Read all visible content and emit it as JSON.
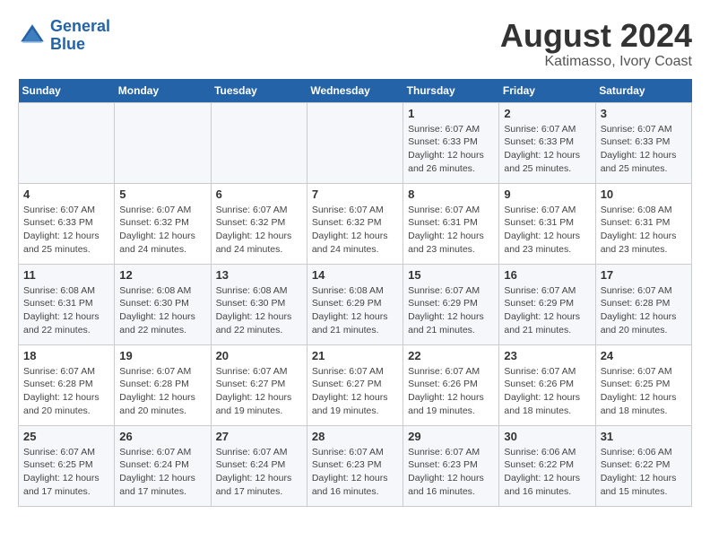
{
  "header": {
    "logo_line1": "General",
    "logo_line2": "Blue",
    "title": "August 2024",
    "subtitle": "Katimasso, Ivory Coast"
  },
  "weekdays": [
    "Sunday",
    "Monday",
    "Tuesday",
    "Wednesday",
    "Thursday",
    "Friday",
    "Saturday"
  ],
  "weeks": [
    [
      {
        "day": "",
        "info": ""
      },
      {
        "day": "",
        "info": ""
      },
      {
        "day": "",
        "info": ""
      },
      {
        "day": "",
        "info": ""
      },
      {
        "day": "1",
        "info": "Sunrise: 6:07 AM\nSunset: 6:33 PM\nDaylight: 12 hours\nand 26 minutes."
      },
      {
        "day": "2",
        "info": "Sunrise: 6:07 AM\nSunset: 6:33 PM\nDaylight: 12 hours\nand 25 minutes."
      },
      {
        "day": "3",
        "info": "Sunrise: 6:07 AM\nSunset: 6:33 PM\nDaylight: 12 hours\nand 25 minutes."
      }
    ],
    [
      {
        "day": "4",
        "info": "Sunrise: 6:07 AM\nSunset: 6:33 PM\nDaylight: 12 hours\nand 25 minutes."
      },
      {
        "day": "5",
        "info": "Sunrise: 6:07 AM\nSunset: 6:32 PM\nDaylight: 12 hours\nand 24 minutes."
      },
      {
        "day": "6",
        "info": "Sunrise: 6:07 AM\nSunset: 6:32 PM\nDaylight: 12 hours\nand 24 minutes."
      },
      {
        "day": "7",
        "info": "Sunrise: 6:07 AM\nSunset: 6:32 PM\nDaylight: 12 hours\nand 24 minutes."
      },
      {
        "day": "8",
        "info": "Sunrise: 6:07 AM\nSunset: 6:31 PM\nDaylight: 12 hours\nand 23 minutes."
      },
      {
        "day": "9",
        "info": "Sunrise: 6:07 AM\nSunset: 6:31 PM\nDaylight: 12 hours\nand 23 minutes."
      },
      {
        "day": "10",
        "info": "Sunrise: 6:08 AM\nSunset: 6:31 PM\nDaylight: 12 hours\nand 23 minutes."
      }
    ],
    [
      {
        "day": "11",
        "info": "Sunrise: 6:08 AM\nSunset: 6:31 PM\nDaylight: 12 hours\nand 22 minutes."
      },
      {
        "day": "12",
        "info": "Sunrise: 6:08 AM\nSunset: 6:30 PM\nDaylight: 12 hours\nand 22 minutes."
      },
      {
        "day": "13",
        "info": "Sunrise: 6:08 AM\nSunset: 6:30 PM\nDaylight: 12 hours\nand 22 minutes."
      },
      {
        "day": "14",
        "info": "Sunrise: 6:08 AM\nSunset: 6:29 PM\nDaylight: 12 hours\nand 21 minutes."
      },
      {
        "day": "15",
        "info": "Sunrise: 6:07 AM\nSunset: 6:29 PM\nDaylight: 12 hours\nand 21 minutes."
      },
      {
        "day": "16",
        "info": "Sunrise: 6:07 AM\nSunset: 6:29 PM\nDaylight: 12 hours\nand 21 minutes."
      },
      {
        "day": "17",
        "info": "Sunrise: 6:07 AM\nSunset: 6:28 PM\nDaylight: 12 hours\nand 20 minutes."
      }
    ],
    [
      {
        "day": "18",
        "info": "Sunrise: 6:07 AM\nSunset: 6:28 PM\nDaylight: 12 hours\nand 20 minutes."
      },
      {
        "day": "19",
        "info": "Sunrise: 6:07 AM\nSunset: 6:28 PM\nDaylight: 12 hours\nand 20 minutes."
      },
      {
        "day": "20",
        "info": "Sunrise: 6:07 AM\nSunset: 6:27 PM\nDaylight: 12 hours\nand 19 minutes."
      },
      {
        "day": "21",
        "info": "Sunrise: 6:07 AM\nSunset: 6:27 PM\nDaylight: 12 hours\nand 19 minutes."
      },
      {
        "day": "22",
        "info": "Sunrise: 6:07 AM\nSunset: 6:26 PM\nDaylight: 12 hours\nand 19 minutes."
      },
      {
        "day": "23",
        "info": "Sunrise: 6:07 AM\nSunset: 6:26 PM\nDaylight: 12 hours\nand 18 minutes."
      },
      {
        "day": "24",
        "info": "Sunrise: 6:07 AM\nSunset: 6:25 PM\nDaylight: 12 hours\nand 18 minutes."
      }
    ],
    [
      {
        "day": "25",
        "info": "Sunrise: 6:07 AM\nSunset: 6:25 PM\nDaylight: 12 hours\nand 17 minutes."
      },
      {
        "day": "26",
        "info": "Sunrise: 6:07 AM\nSunset: 6:24 PM\nDaylight: 12 hours\nand 17 minutes."
      },
      {
        "day": "27",
        "info": "Sunrise: 6:07 AM\nSunset: 6:24 PM\nDaylight: 12 hours\nand 17 minutes."
      },
      {
        "day": "28",
        "info": "Sunrise: 6:07 AM\nSunset: 6:23 PM\nDaylight: 12 hours\nand 16 minutes."
      },
      {
        "day": "29",
        "info": "Sunrise: 6:07 AM\nSunset: 6:23 PM\nDaylight: 12 hours\nand 16 minutes."
      },
      {
        "day": "30",
        "info": "Sunrise: 6:06 AM\nSunset: 6:22 PM\nDaylight: 12 hours\nand 16 minutes."
      },
      {
        "day": "31",
        "info": "Sunrise: 6:06 AM\nSunset: 6:22 PM\nDaylight: 12 hours\nand 15 minutes."
      }
    ]
  ]
}
